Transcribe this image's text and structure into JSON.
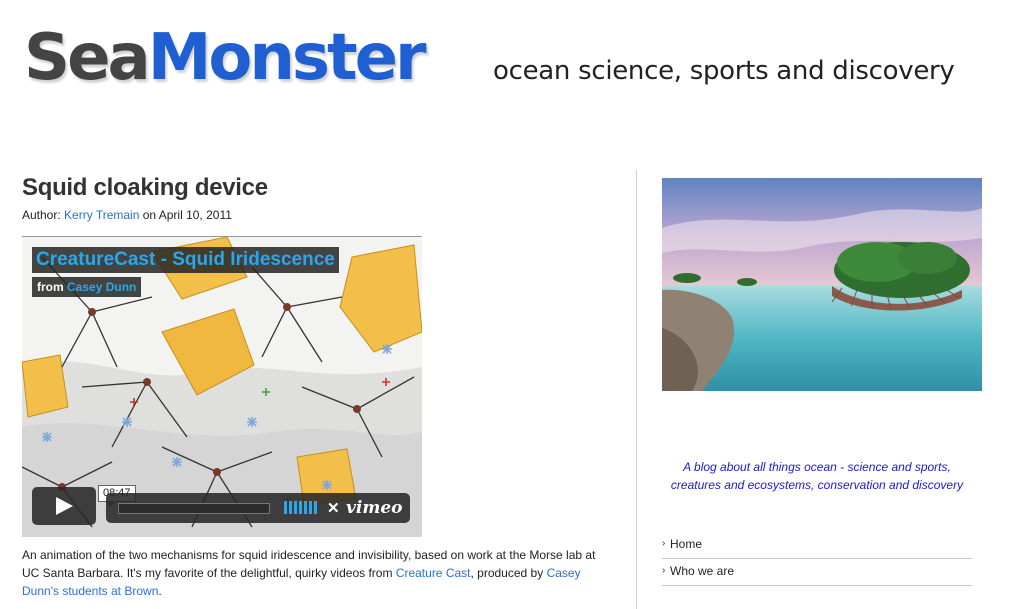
{
  "header": {
    "logo_part1": "Sea",
    "logo_part2": "Monster",
    "tagline": "ocean science, sports and discovery"
  },
  "post": {
    "title": "Squid cloaking device",
    "author_prefix": "Author: ",
    "author": "Kerry Tremain",
    "date_text": " on April 10, 2011",
    "video": {
      "title": "CreatureCast - Squid Iridescence",
      "from_label": "from ",
      "from_author": "Casey Dunn",
      "duration": "08:47",
      "brand": "vimeo"
    },
    "description": {
      "text1": "An animation of the two mechanisms for squid iridescence and invisibility, based on work at the Morse lab at UC Santa Barbara. It's my favorite of the delightful, quirky videos from ",
      "link1": "Creature Cast",
      "text2": ", produced by ",
      "link2": "Casey Dunn's students at Brown",
      "text3": "."
    }
  },
  "sidebar": {
    "blurb": "A blog about all things ocean - science and sports, creatures and ecosystems, conservation and discovery",
    "nav": [
      {
        "label": "Home"
      },
      {
        "label": "Who we are"
      }
    ]
  },
  "colors": {
    "brand_blue": "#1f5fd1",
    "logo_gray": "#444444",
    "link_blue": "#2a6fd6",
    "vimeo_blue": "#29a7ea",
    "blurb_blue": "#1a1ad0"
  }
}
